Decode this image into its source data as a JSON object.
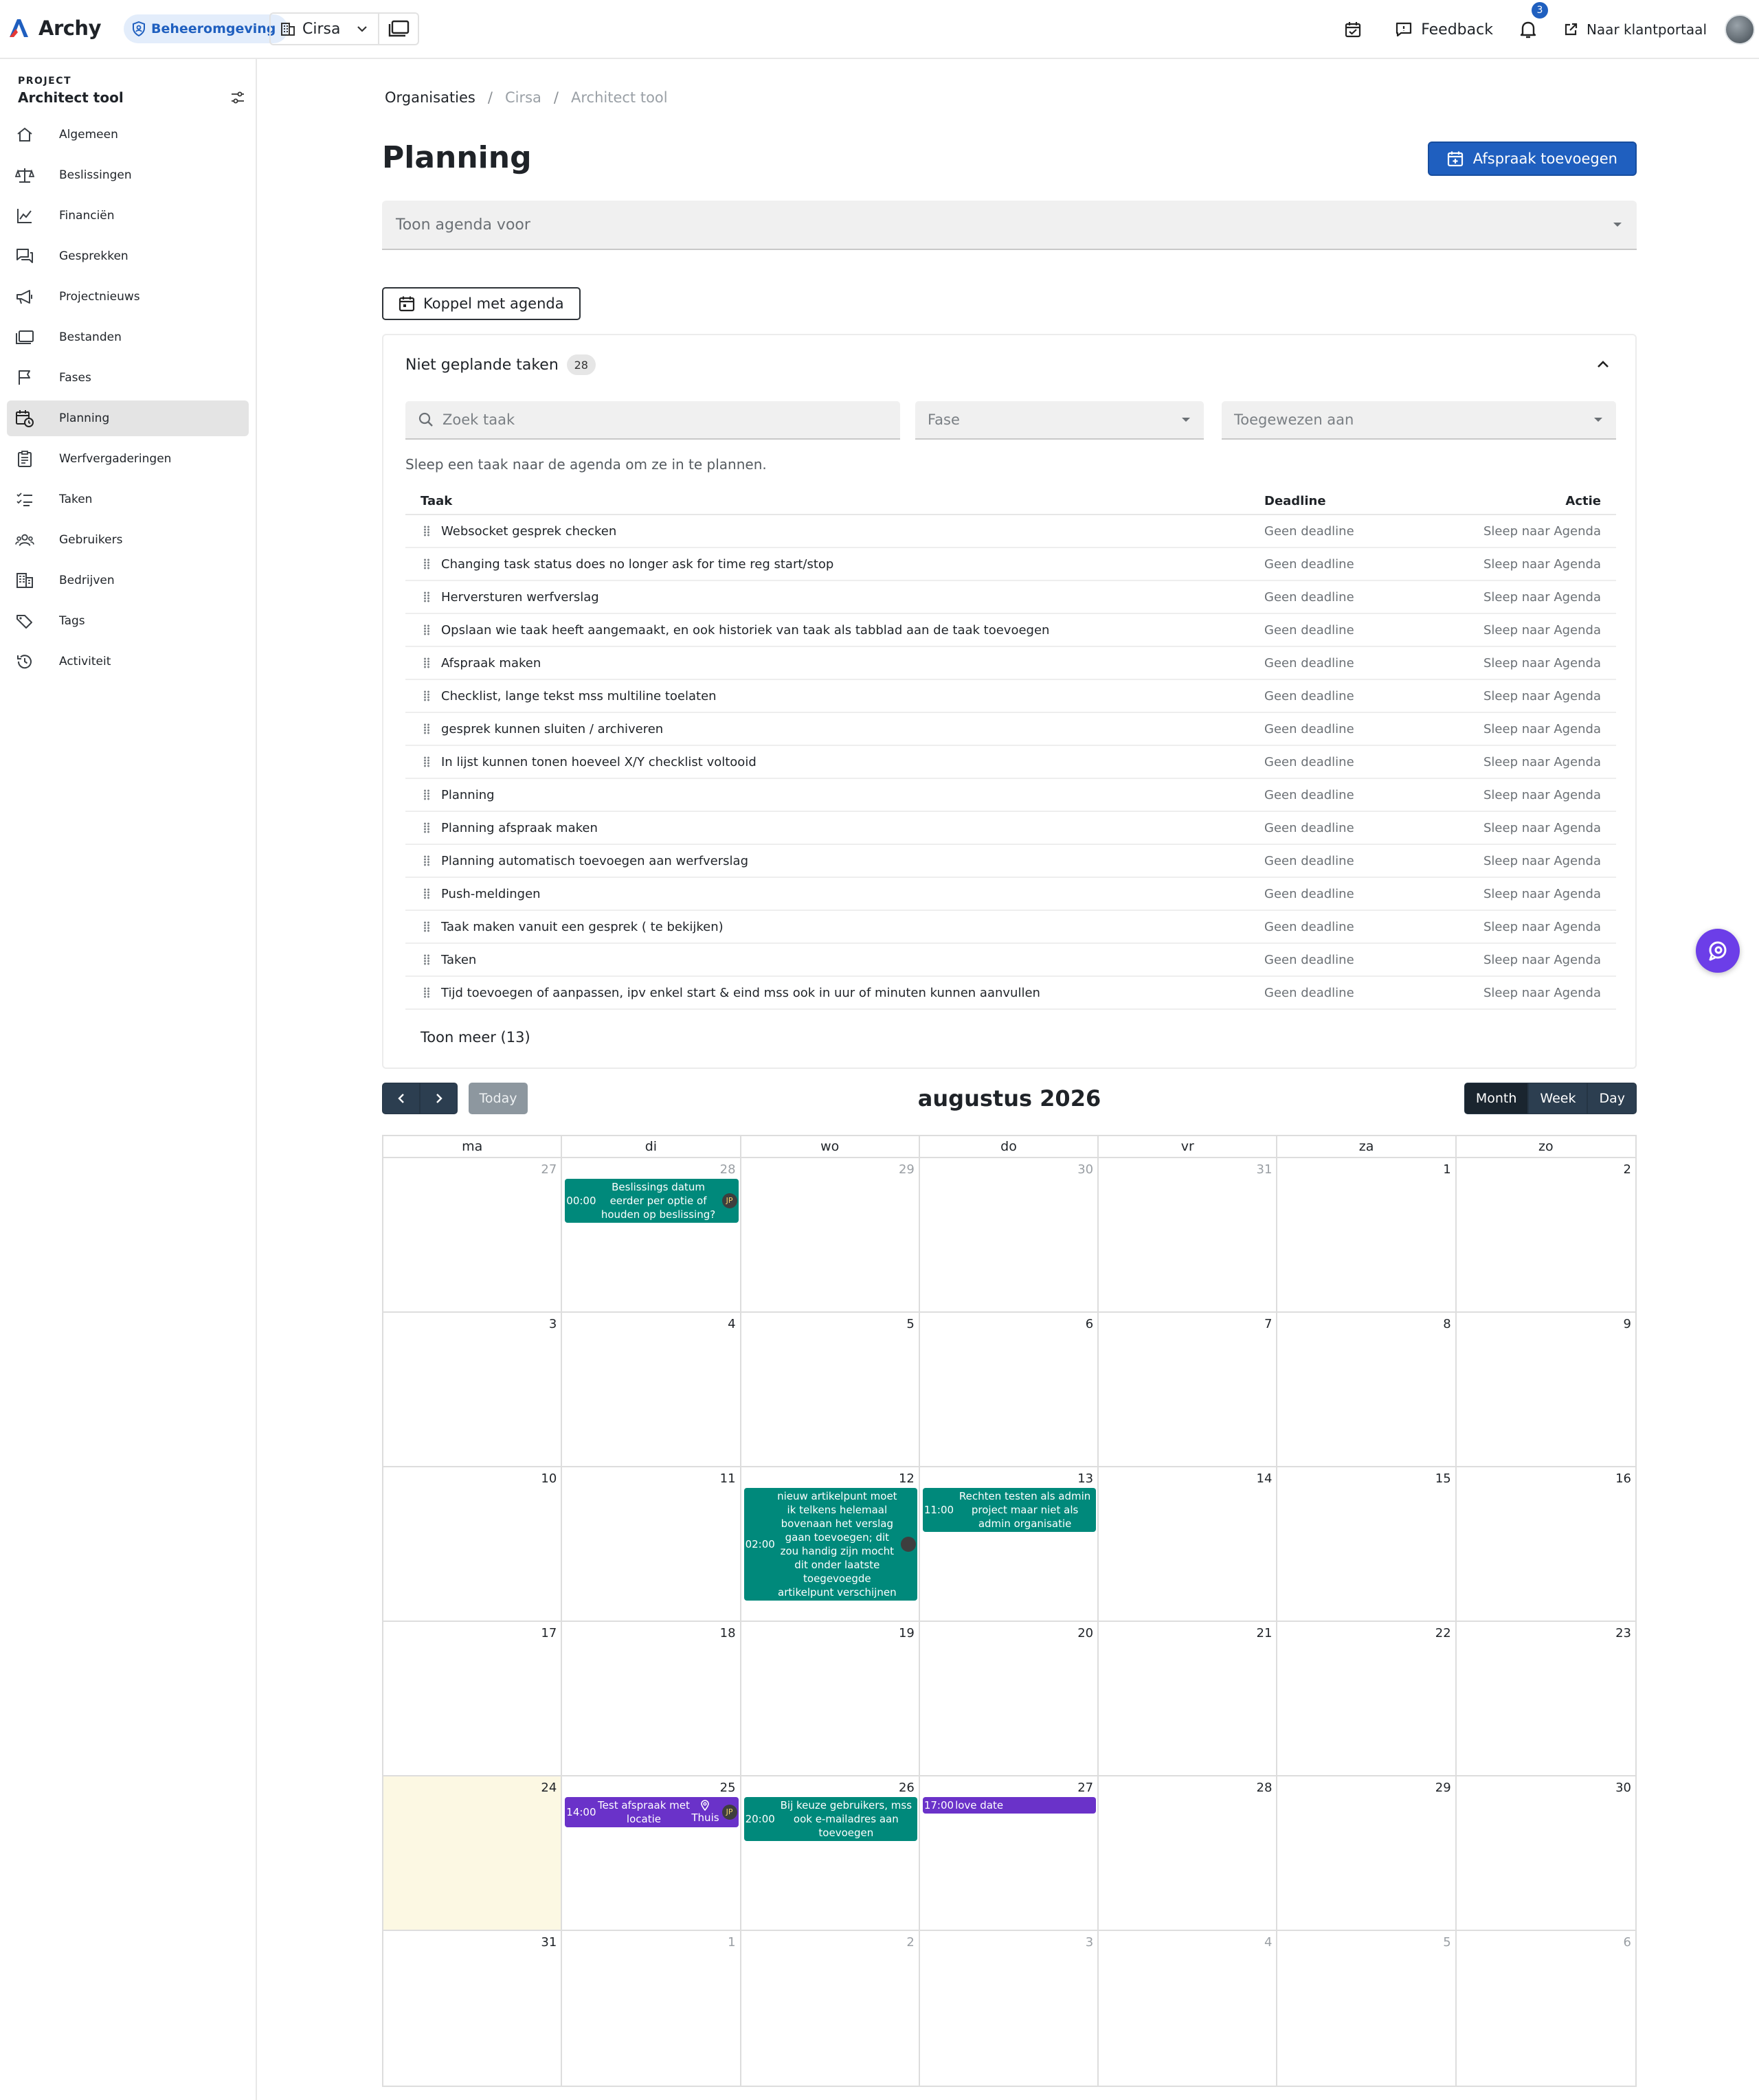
{
  "header": {
    "logo_text": "Archy",
    "environment": "Beheeromgeving",
    "organisation": "Cirsa",
    "feedback_label": "Feedback",
    "notification_count": "3",
    "portal_label": "Naar klantportaal"
  },
  "sidebar": {
    "project_label": "PROJECT",
    "project_name": "Architect tool",
    "items": [
      {
        "label": "Algemeen",
        "icon": "home-icon"
      },
      {
        "label": "Beslissingen",
        "icon": "scale-icon"
      },
      {
        "label": "Financiën",
        "icon": "chart-line-icon"
      },
      {
        "label": "Gesprekken",
        "icon": "chat-icon"
      },
      {
        "label": "Projectnieuws",
        "icon": "megaphone-icon"
      },
      {
        "label": "Bestanden",
        "icon": "folder-icon"
      },
      {
        "label": "Fases",
        "icon": "flag-icon"
      },
      {
        "label": "Planning",
        "icon": "calendar-clock-icon",
        "active": true
      },
      {
        "label": "Werfvergaderingen",
        "icon": "clipboard-icon"
      },
      {
        "label": "Taken",
        "icon": "checklist-icon"
      },
      {
        "label": "Gebruikers",
        "icon": "users-icon"
      },
      {
        "label": "Bedrijven",
        "icon": "building-icon"
      },
      {
        "label": "Tags",
        "icon": "tag-icon"
      },
      {
        "label": "Activiteit",
        "icon": "history-icon"
      }
    ]
  },
  "breadcrumb": {
    "b1": "Organisaties",
    "b2": "Cirsa",
    "b3": "Architect tool"
  },
  "page": {
    "title": "Planning",
    "add_button": "Afspraak toevoegen",
    "agenda_select_placeholder": "Toon agenda voor",
    "link_agenda_button": "Koppel met agenda"
  },
  "tasks": {
    "title": "Niet geplande taken",
    "count": "28",
    "search_placeholder": "Zoek taak",
    "phase_placeholder": "Fase",
    "assignee_placeholder": "Toegewezen aan",
    "hint": "Sleep een taak naar de agenda om ze in te plannen.",
    "columns": {
      "task": "Taak",
      "deadline": "Deadline",
      "action": "Actie"
    },
    "rows": [
      {
        "name": "Websocket gesprek checken",
        "deadline": "Geen deadline",
        "action": "Sleep naar Agenda"
      },
      {
        "name": "Changing task status does no longer ask for time reg start/stop",
        "deadline": "Geen deadline",
        "action": "Sleep naar Agenda"
      },
      {
        "name": "Herversturen werfverslag",
        "deadline": "Geen deadline",
        "action": "Sleep naar Agenda"
      },
      {
        "name": "Opslaan wie taak heeft aangemaakt, en ook historiek van taak als tabblad aan de taak toevoegen",
        "deadline": "Geen deadline",
        "action": "Sleep naar Agenda"
      },
      {
        "name": "Afspraak maken",
        "deadline": "Geen deadline",
        "action": "Sleep naar Agenda"
      },
      {
        "name": "Checklist, lange tekst mss multiline toelaten",
        "deadline": "Geen deadline",
        "action": "Sleep naar Agenda"
      },
      {
        "name": "gesprek kunnen sluiten / archiveren",
        "deadline": "Geen deadline",
        "action": "Sleep naar Agenda"
      },
      {
        "name": "In lijst kunnen tonen hoeveel X/Y checklist voltooid",
        "deadline": "Geen deadline",
        "action": "Sleep naar Agenda"
      },
      {
        "name": "Planning",
        "deadline": "Geen deadline",
        "action": "Sleep naar Agenda"
      },
      {
        "name": "Planning afspraak maken",
        "deadline": "Geen deadline",
        "action": "Sleep naar Agenda"
      },
      {
        "name": "Planning automatisch toevoegen aan werfverslag",
        "deadline": "Geen deadline",
        "action": "Sleep naar Agenda"
      },
      {
        "name": "Push-meldingen",
        "deadline": "Geen deadline",
        "action": "Sleep naar Agenda"
      },
      {
        "name": "Taak maken vanuit een gesprek ( te bekijken)",
        "deadline": "Geen deadline",
        "action": "Sleep naar Agenda"
      },
      {
        "name": "Taken",
        "deadline": "Geen deadline",
        "action": "Sleep naar Agenda"
      },
      {
        "name": "Tijd toevoegen of aanpassen, ipv enkel start & eind mss ook in uur of minuten kunnen aanvullen",
        "deadline": "Geen deadline",
        "action": "Sleep naar Agenda"
      }
    ],
    "show_more": "Toon meer (13)"
  },
  "calendar": {
    "title": "augustus 2026",
    "today_label": "Today",
    "views": [
      "Month",
      "Week",
      "Day"
    ],
    "active_view": "Month",
    "weekdays": [
      "ma",
      "di",
      "wo",
      "do",
      "vr",
      "za",
      "zo"
    ],
    "weeks": [
      [
        {
          "num": "27",
          "other": true
        },
        {
          "num": "28",
          "other": true,
          "events": [
            {
              "time": "00:00",
              "text": "Beslissings datum eerder per optie of houden op beslissing?",
              "color": "teal",
              "avatar": "JP",
              "offset": 30
            }
          ]
        },
        {
          "num": "29",
          "other": true
        },
        {
          "num": "30",
          "other": true
        },
        {
          "num": "31",
          "other": true
        },
        {
          "num": "1"
        },
        {
          "num": "2"
        }
      ],
      [
        {
          "num": "3"
        },
        {
          "num": "4"
        },
        {
          "num": "5"
        },
        {
          "num": "6"
        },
        {
          "num": "7"
        },
        {
          "num": "8"
        },
        {
          "num": "9"
        }
      ],
      [
        {
          "num": "10"
        },
        {
          "num": "11"
        },
        {
          "num": "12",
          "events": [
            {
              "time": "02:00",
              "text": "nieuw artikelpunt moet ik telkens helemaal bovenaan het verslag gaan toevoegen; dit zou handig zijn mocht dit onder laatste toegevoegde artikelpunt verschijnen",
              "color": "teal",
              "avatar": "",
              "offset": 30
            }
          ]
        },
        {
          "num": "13",
          "events": [
            {
              "time": "11:00",
              "text": "Rechten testen als admin project maar niet als admin organisatie",
              "color": "teal",
              "offset": 30
            }
          ]
        },
        {
          "num": "14"
        },
        {
          "num": "15"
        },
        {
          "num": "16"
        }
      ],
      [
        {
          "num": "17"
        },
        {
          "num": "18"
        },
        {
          "num": "19"
        },
        {
          "num": "20"
        },
        {
          "num": "21"
        },
        {
          "num": "22"
        },
        {
          "num": "23"
        }
      ],
      [
        {
          "num": "24",
          "today": true
        },
        {
          "num": "25",
          "events": [
            {
              "time": "14:00",
              "text": "Test afspraak met locatie",
              "color": "purple",
              "location": "Thuis",
              "avatar": "JP",
              "offset": 30
            }
          ]
        },
        {
          "num": "26",
          "events": [
            {
              "time": "20:00",
              "text": "Bij keuze gebruikers, mss ook e-mailadres aan toevoegen",
              "color": "teal",
              "offset": 30
            }
          ]
        },
        {
          "num": "27",
          "events": [
            {
              "time": "17:00",
              "text": "love date",
              "color": "purple",
              "offset": 30,
              "inline": true
            }
          ]
        },
        {
          "num": "28"
        },
        {
          "num": "29"
        },
        {
          "num": "30"
        }
      ],
      [
        {
          "num": "31"
        },
        {
          "num": "1",
          "other": true
        },
        {
          "num": "2",
          "other": true
        },
        {
          "num": "3",
          "other": true
        },
        {
          "num": "4",
          "other": true
        },
        {
          "num": "5",
          "other": true
        },
        {
          "num": "6",
          "other": true
        }
      ]
    ]
  },
  "colors": {
    "primary": "#1f5fbf",
    "teal_event": "#00897b",
    "purple_event": "#6a32c9",
    "today_bg": "#fcf8e3",
    "toolbar_dark": "#2c3e50"
  }
}
